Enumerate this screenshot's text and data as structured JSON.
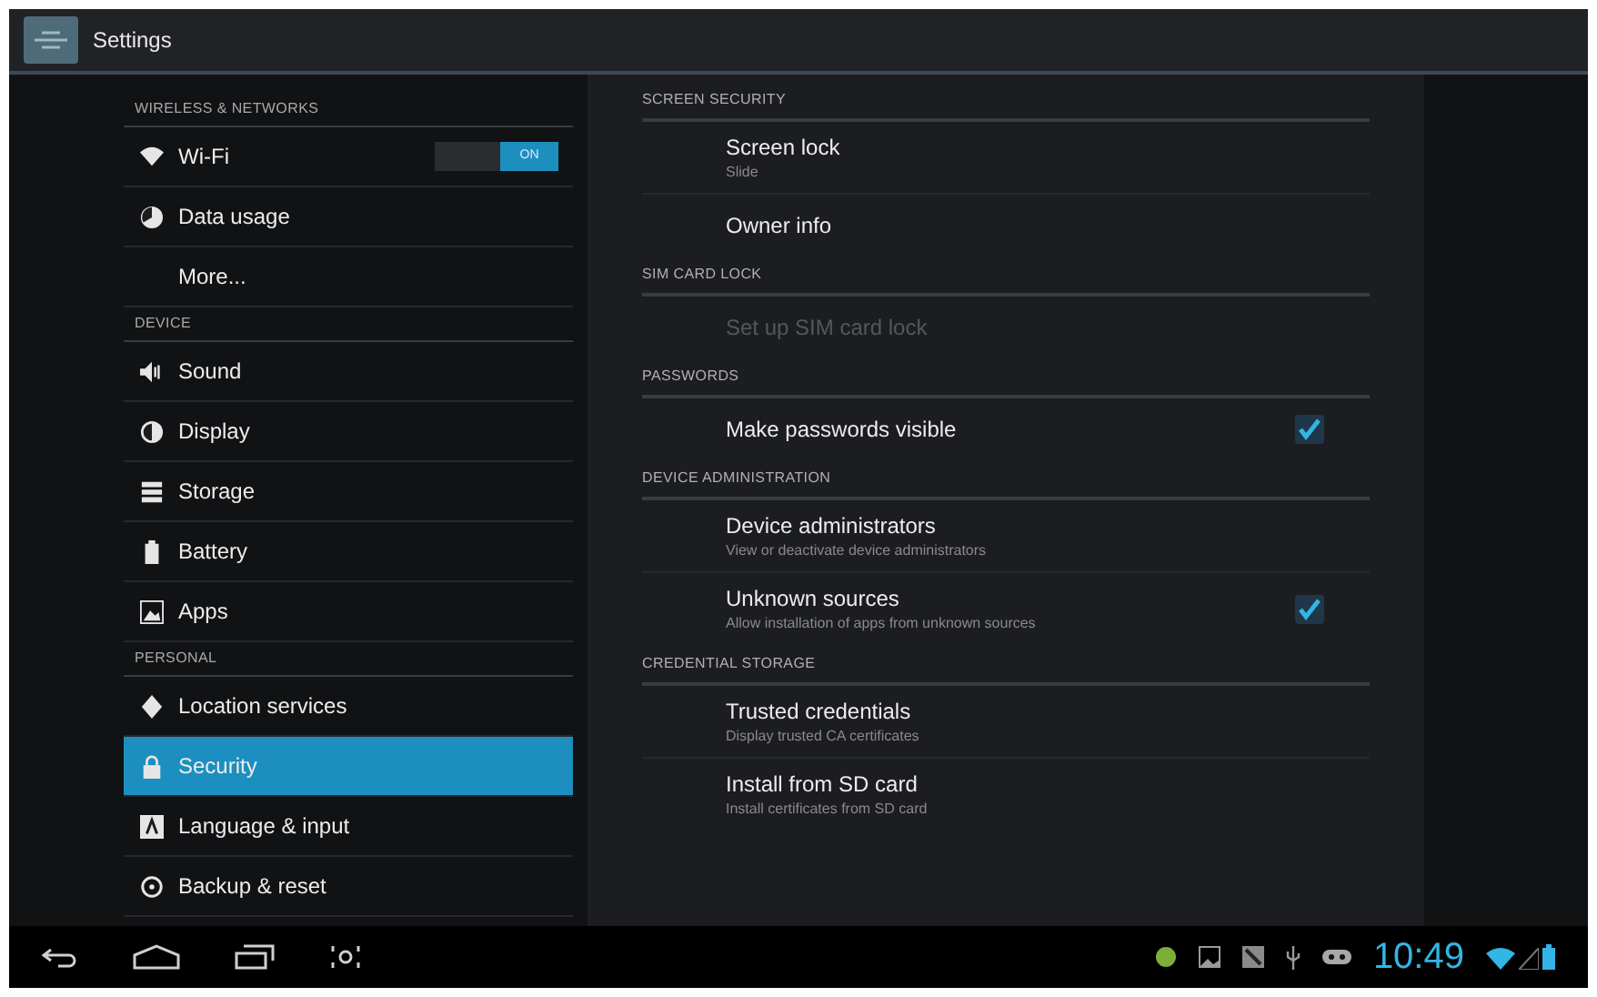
{
  "action_bar": {
    "title": "Settings"
  },
  "sidebar": {
    "sections": [
      {
        "header": "WIRELESS & NETWORKS",
        "items": [
          {
            "label": "Wi-Fi",
            "kind": "wifi",
            "selected": false,
            "toggle": {
              "label": "ON",
              "on": true
            }
          },
          {
            "label": "Data usage",
            "kind": "data",
            "selected": false
          },
          {
            "label": "More...",
            "kind": "plain",
            "selected": false
          }
        ]
      },
      {
        "header": "DEVICE",
        "items": [
          {
            "label": "Sound",
            "kind": "sound",
            "selected": false
          },
          {
            "label": "Display",
            "kind": "display",
            "selected": false
          },
          {
            "label": "Storage",
            "kind": "storage",
            "selected": false
          },
          {
            "label": "Battery",
            "kind": "battery",
            "selected": false
          },
          {
            "label": "Apps",
            "kind": "apps",
            "selected": false
          }
        ]
      },
      {
        "header": "PERSONAL",
        "items": [
          {
            "label": "Location services",
            "kind": "location",
            "selected": false
          },
          {
            "label": "Security",
            "kind": "lock",
            "selected": true
          },
          {
            "label": "Language & input",
            "kind": "language",
            "selected": false
          },
          {
            "label": "Backup & reset",
            "kind": "backup",
            "selected": false
          }
        ]
      }
    ]
  },
  "detail": {
    "sections": [
      {
        "header": "SCREEN SECURITY",
        "items": [
          {
            "title": "Screen lock",
            "summary": "Slide",
            "disabled": false
          },
          {
            "title": "Owner info",
            "disabled": false
          }
        ]
      },
      {
        "header": "SIM CARD LOCK",
        "items": [
          {
            "title": "Set up SIM card lock",
            "disabled": true
          }
        ]
      },
      {
        "header": "PASSWORDS",
        "items": [
          {
            "title": "Make passwords visible",
            "disabled": false,
            "checked": true
          }
        ]
      },
      {
        "header": "DEVICE ADMINISTRATION",
        "items": [
          {
            "title": "Device administrators",
            "summary": "View or deactivate device administrators",
            "disabled": false
          },
          {
            "title": "Unknown sources",
            "summary": "Allow installation of apps from unknown sources",
            "disabled": false,
            "checked": true
          }
        ]
      },
      {
        "header": "CREDENTIAL STORAGE",
        "items": [
          {
            "title": "Trusted credentials",
            "summary": "Display trusted CA certificates",
            "disabled": false
          },
          {
            "title": "Install from SD card",
            "summary": "Install certificates from SD card",
            "disabled": false
          }
        ]
      }
    ]
  },
  "status_bar": {
    "time": "10:49"
  }
}
